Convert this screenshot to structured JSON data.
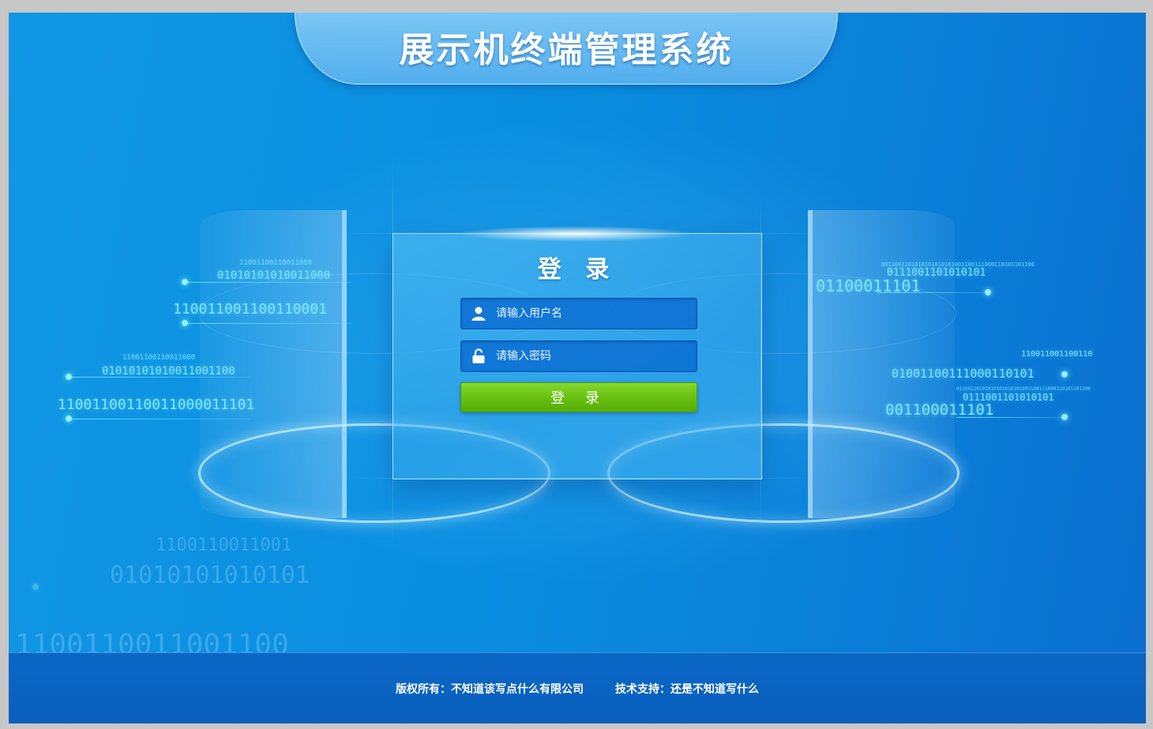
{
  "header": {
    "title": "展示机终端管理系统"
  },
  "login": {
    "title": "登 录",
    "username_placeholder": "请输入用户名",
    "password_placeholder": "请输入密码",
    "submit_label": "登 录"
  },
  "decor": {
    "left": {
      "row1_small": "11001100110011000",
      "row1": "01010101010011000",
      "row2": "110011001100110001",
      "row3_small": "11001100110011000",
      "row3": "01010101010011001100",
      "row4": "11001100110011000011101"
    },
    "right": {
      "row1_small": "0011001101010101010101001100111000110101101100",
      "row1": "0111001101010101",
      "row2": "01100011101",
      "row3_small": "110011001100110",
      "row3": "01001100111000110101",
      "row4_small": "01100110101010101010101001100111000110101101100",
      "row4_mid": "0111001101010101",
      "row5": "001100011101"
    },
    "faint": {
      "row1": "1100110011001",
      "row2": "01010101010101",
      "row3": "1100110011001100"
    }
  },
  "footer": {
    "copyright": "版权所有：不知道该写点什么有限公司",
    "support": "技术支持：还是不知道写什么"
  },
  "colors": {
    "background": "#0a8ee0",
    "button": "#66bf10",
    "footer": "#0a67c6"
  }
}
